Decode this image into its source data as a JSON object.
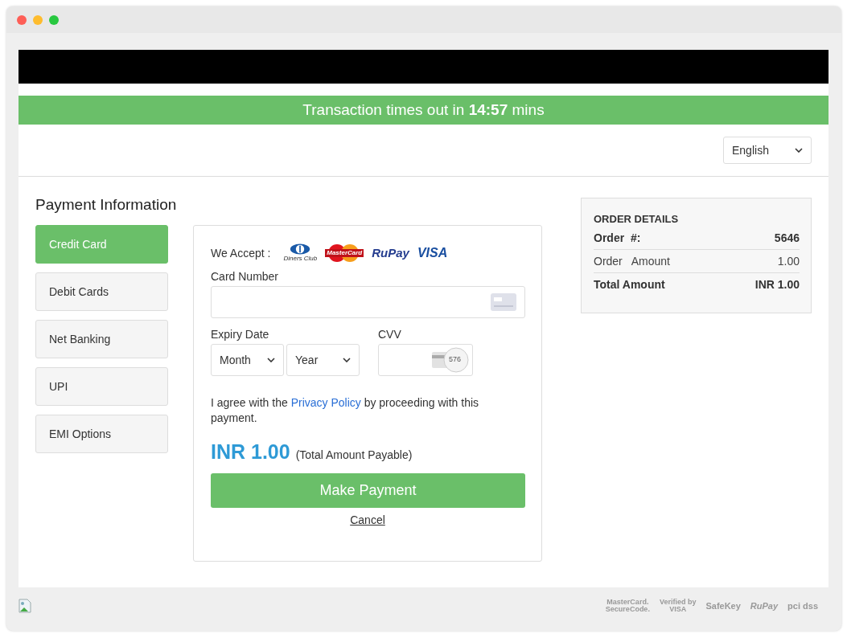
{
  "window": {
    "controls": [
      {
        "color": "#fe5f57"
      },
      {
        "color": "#febc2e"
      },
      {
        "color": "#28c840"
      }
    ]
  },
  "timer": {
    "text": "Transaction times out in **14:57** mins"
  },
  "language": {
    "value": "English"
  },
  "payment": {
    "title": "Payment Information",
    "methods": [
      {
        "label": "Credit Card",
        "selected": true
      },
      {
        "label": "Debit Cards",
        "selected": false
      },
      {
        "label": "Net Banking",
        "selected": false
      },
      {
        "label": "UPI",
        "selected": false
      },
      {
        "label": "EMI Options",
        "selected": false
      }
    ]
  },
  "form": {
    "accept_label": "We Accept :",
    "cards": [
      {
        "kind": "diners",
        "label": "Diners Club"
      },
      {
        "kind": "mastercard",
        "label": "MasterCard"
      },
      {
        "kind": "rupay",
        "label": "RuPay"
      },
      {
        "kind": "visa",
        "label": "VISA"
      }
    ],
    "card_number": {
      "label": "Card Number"
    },
    "expiry": {
      "label": "Expiry Date",
      "month": "Month",
      "year": "Year"
    },
    "cvv": {
      "label": "CVV",
      "hint": "576"
    },
    "agreement": {
      "before": "I agree with the",
      "link": "Privacy Policy",
      "after": "by proceeding with this payment."
    },
    "amount": "INR 1.00",
    "amount_note": "(Total Amount Payable)",
    "submit": "Make Payment",
    "cancel": "Cancel"
  },
  "order": {
    "title": "ORDER DETAILS",
    "rows": [
      {
        "kind": "header",
        "label": "Order  #:",
        "value": "5646"
      },
      {
        "kind": "plain",
        "label": "Order   Amount",
        "value": "1.00"
      },
      {
        "kind": "total",
        "label": "Total Amount",
        "value": "INR 1.00"
      }
    ]
  },
  "footer": {
    "badges": [
      {
        "kind": "stacked",
        "text": "MasterCard.\nSecureCode."
      },
      {
        "kind": "stacked",
        "text": "Verified by\nVISA"
      },
      {
        "kind": "plain",
        "text": "SafeKey"
      },
      {
        "kind": "italic",
        "text": "RuPay"
      },
      {
        "kind": "plain",
        "text": "pci dss"
      }
    ]
  }
}
